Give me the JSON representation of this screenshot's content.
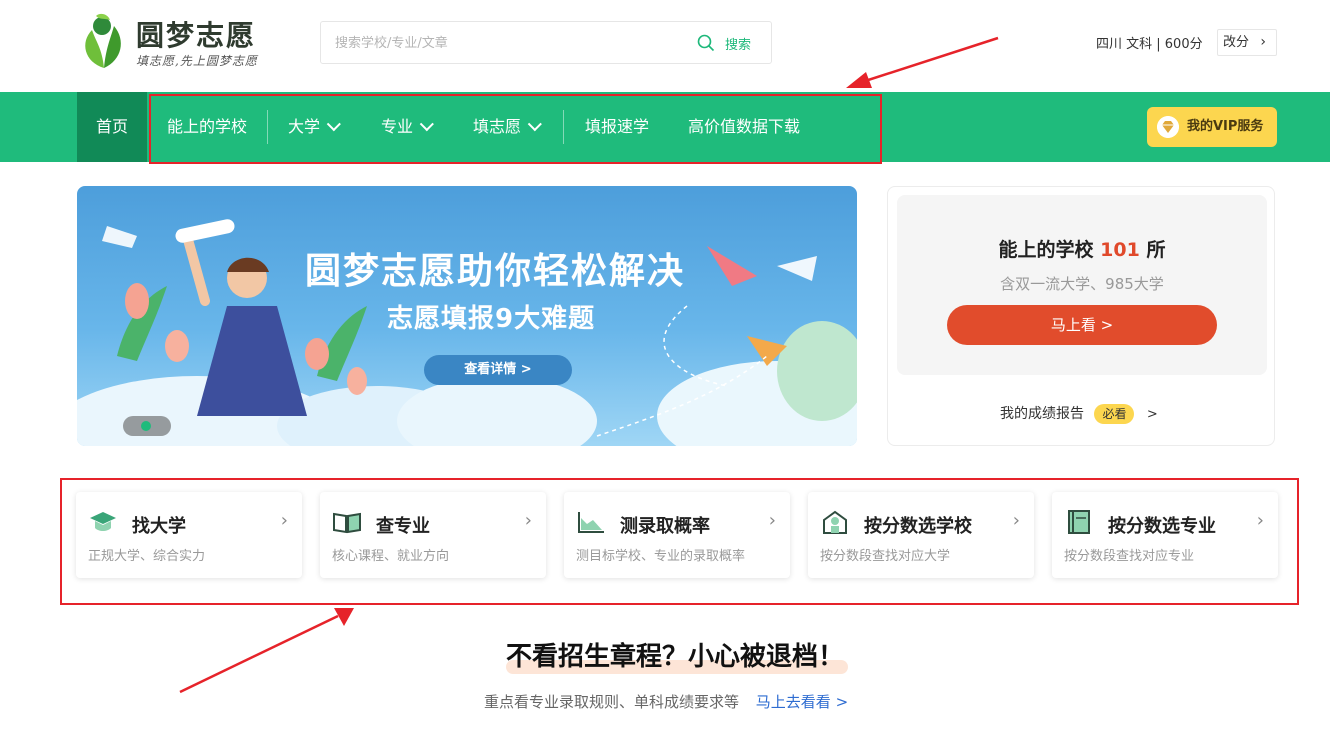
{
  "header": {
    "logo_title": "圆梦志愿",
    "logo_slogan": "填志愿,先上圆梦志愿",
    "search_placeholder": "搜索学校/专业/文章",
    "search_button": "搜索",
    "score_info": "四川 文科 | 600分",
    "change_score": "改分"
  },
  "nav": {
    "home": "首页",
    "items": [
      "能上的学校",
      "大学",
      "专业",
      "填志愿",
      "填报速学",
      "高价值数据下载"
    ],
    "vip": "我的VIP服务"
  },
  "banner": {
    "title": "圆梦志愿助你轻松解决",
    "subtitle": "志愿填报9大难题",
    "button": "查看详情 >"
  },
  "side_card": {
    "title_prefix": "能上的学校",
    "count": "101",
    "title_suffix": "所",
    "subtitle": "含双一流大学、985大学",
    "button": "马上看 >",
    "report": "我的成绩报告",
    "report_badge": "必看",
    "report_chevron": ">"
  },
  "features": [
    {
      "title": "找大学",
      "desc": "正规大学、综合实力",
      "icon": "graduation-cap-icon"
    },
    {
      "title": "查专业",
      "desc": "核心课程、就业方向",
      "icon": "open-book-icon"
    },
    {
      "title": "测录取概率",
      "desc": "测目标学校、专业的录取概率",
      "icon": "area-chart-icon"
    },
    {
      "title": "按分数选学校",
      "desc": "按分数段查找对应大学",
      "icon": "school-building-icon"
    },
    {
      "title": "按分数选专业",
      "desc": "按分数段查找对应专业",
      "icon": "book-stack-icon"
    }
  ],
  "promo": {
    "title": "不看招生章程？小心被退档！",
    "subtitle": "重点看专业录取规则、单科成绩要求等",
    "link": "马上去看看 >"
  },
  "colors": {
    "brand_green": "#1fbb7c",
    "nav_active": "#118a57",
    "accent_red": "#e14c2c",
    "vip_yellow": "#fcd64f",
    "annotation_red": "#e6232a"
  }
}
